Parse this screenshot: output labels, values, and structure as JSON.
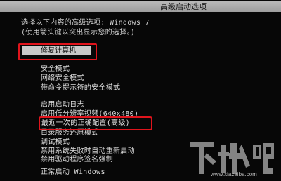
{
  "title_bar": {
    "text": "高级启动选项"
  },
  "prompt": {
    "line1": "选择以下内容的高级选项: Windows 7",
    "line2": "(使用箭头键以突出显示您的选择。)"
  },
  "repair_option": {
    "label": "修复计算机",
    "selected": true
  },
  "menu_items": [
    {
      "label": "安全模式"
    },
    {
      "label": "网络安全模式"
    },
    {
      "label": "带命令提示符的安全模式"
    },
    {
      "label": "启用启动日志"
    },
    {
      "label": "启用低分辨率视频(640x480)"
    },
    {
      "label": "最近一次的正确配置(高级)"
    },
    {
      "label": "目录服务还原模式"
    },
    {
      "label": "调试模式"
    },
    {
      "label": "禁用系统失败时自动重新启动"
    },
    {
      "label": "禁用驱动程序签名强制"
    },
    {
      "label": "正常启动 Windows"
    }
  ],
  "annotations": {
    "highlight_color": "#e0141c"
  },
  "watermark": {
    "logo_text": "下载吧",
    "url_text": "www.xiazaiba.com"
  }
}
